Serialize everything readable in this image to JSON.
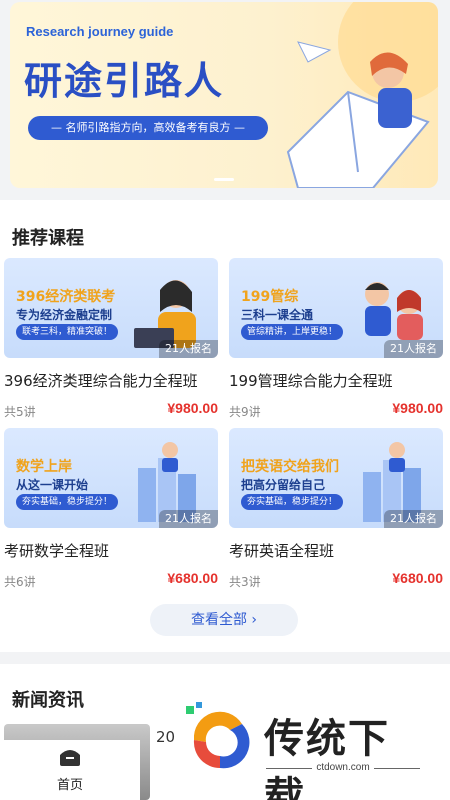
{
  "banner": {
    "en_title": "Research journey guide",
    "cn_title": "研途引路人",
    "tagline": "— 名师引路指方向，高效备考有良方 —"
  },
  "recommend": {
    "title": "推荐课程",
    "view_all": "查看全部",
    "courses": [
      {
        "thumb_line1": "396经济类联考",
        "thumb_line2": "专为经济金融定制",
        "thumb_line3": "联考三科，精准突破！",
        "signups": "21人报名",
        "title": "396经济类理综合能力全程班",
        "lessons": "共5讲",
        "price": "¥980.00"
      },
      {
        "thumb_line1": "199管综",
        "thumb_line2": "三科一课全通",
        "thumb_line3": "管综精讲，上岸更稳！",
        "signups": "21人报名",
        "title": "199管理综合能力全程班",
        "lessons": "共9讲",
        "price": "¥980.00"
      },
      {
        "thumb_line1": "数学上岸",
        "thumb_line2": "从这一课开始",
        "thumb_line3": "夯实基础，稳步提分！",
        "signups": "21人报名",
        "title": "考研数学全程班",
        "lessons": "共6讲",
        "price": "¥680.00"
      },
      {
        "thumb_line1": "把英语交给我们",
        "thumb_line2": "把高分留给自己",
        "thumb_line3": "夯实基础，稳步提分！",
        "signups": "21人报名",
        "title": "考研英语全程班",
        "lessons": "共3讲",
        "price": "¥680.00"
      }
    ]
  },
  "news": {
    "title": "新闻资讯",
    "first_item_prefix": "20"
  },
  "watermark": {
    "text": "传统下载",
    "url": "ctdown.com"
  },
  "tabbar": {
    "home_label": "首页",
    "home_icon": "home-icon"
  },
  "colors": {
    "accent": "#2f5bd1",
    "price": "#e5322d",
    "thumb_orange": "#f0a31c"
  }
}
